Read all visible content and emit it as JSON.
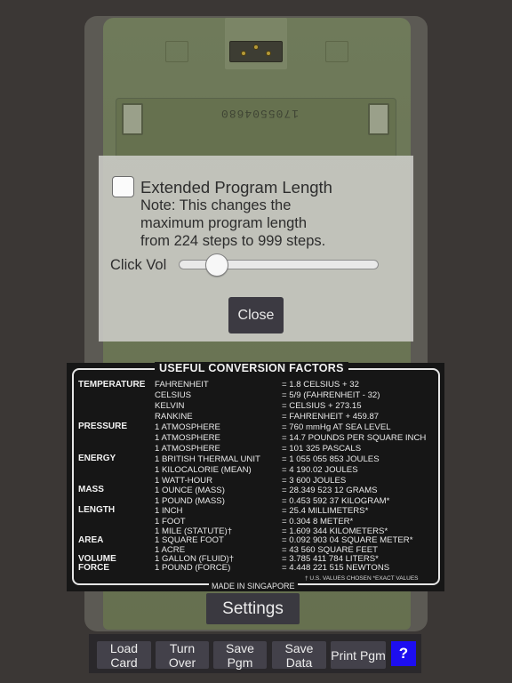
{
  "calculator": {
    "serial_number": "1705504680"
  },
  "settings_dialog": {
    "extended_label": "Extended Program Length",
    "extended_checked": false,
    "note_lines": [
      "Note: This changes the",
      "maximum program length",
      "from 224 steps to 999 steps."
    ],
    "click_vol_label": "Click Vol",
    "click_vol_value_fraction": 0.15,
    "close_label": "Close"
  },
  "conversion_panel": {
    "title": "USEFUL CONVERSION FACTORS",
    "categories": [
      "TEMPERATURE",
      "PRESSURE",
      "ENERGY",
      "MASS",
      "LENGTH",
      "AREA",
      "VOLUME",
      "FORCE"
    ],
    "rows": [
      {
        "unit": "FAHRENHEIT",
        "value": "= 1.8 CELSIUS + 32"
      },
      {
        "unit": "CELSIUS",
        "value": "= 5/9 (FAHRENHEIT - 32)"
      },
      {
        "unit": "KELVIN",
        "value": "= CELSIUS + 273.15"
      },
      {
        "unit": "RANKINE",
        "value": "= FAHRENHEIT + 459.87"
      },
      {
        "unit": "1 ATMOSPHERE",
        "value": "= 760 mmHg AT SEA LEVEL"
      },
      {
        "unit": "1 ATMOSPHERE",
        "value": "= 14.7 POUNDS PER SQUARE INCH"
      },
      {
        "unit": "1 ATMOSPHERE",
        "value": "= 101 325 PASCALS"
      },
      {
        "unit": "1 BRITISH THERMAL UNIT",
        "value": "= 1 055 055 853 JOULES"
      },
      {
        "unit": "1 KILOCALORIE (MEAN)",
        "value": "= 4 190.02 JOULES"
      },
      {
        "unit": "1 WATT-HOUR",
        "value": "= 3 600 JOULES"
      },
      {
        "unit": "1 OUNCE (MASS)",
        "value": "= 28.349 523 12 GRAMS"
      },
      {
        "unit": "1 POUND (MASS)",
        "value": "= 0.453 592 37 KILOGRAM*"
      },
      {
        "unit": "1 INCH",
        "value": "= 25.4 MILLIMETERS*"
      },
      {
        "unit": "1 FOOT",
        "value": "= 0.304 8 METER*"
      },
      {
        "unit": "1 MILE (STATUTE)†",
        "value": "= 1.609 344 KILOMETERS*"
      },
      {
        "unit": "1 SQUARE FOOT",
        "value": "= 0.092 903 04 SQUARE METER*"
      },
      {
        "unit": "1 ACRE",
        "value": "= 43 560 SQUARE FEET"
      },
      {
        "unit": "1 GALLON (FLUID)†",
        "value": "= 3.785 411 784 LITERS*"
      },
      {
        "unit": "1 POUND (FORCE)",
        "value": "= 4.448 221 515 NEWTONS"
      }
    ],
    "footnote": "† U.S. VALUES CHOSEN   *EXACT VALUES",
    "made_in": "MADE IN SINGAPORE"
  },
  "settings_button": "Settings",
  "toolbar": {
    "load_card": "Load Card",
    "turn_over": "Turn Over",
    "save_pgm": "Save Pgm",
    "save_data": "Save Data",
    "print_pgm": "Print Pgm",
    "help": "?"
  },
  "colors": {
    "calculator_green": "#6b7656",
    "panel_black": "#161616",
    "help_blue": "#1d0ef0",
    "button_dark": "#43414a"
  }
}
